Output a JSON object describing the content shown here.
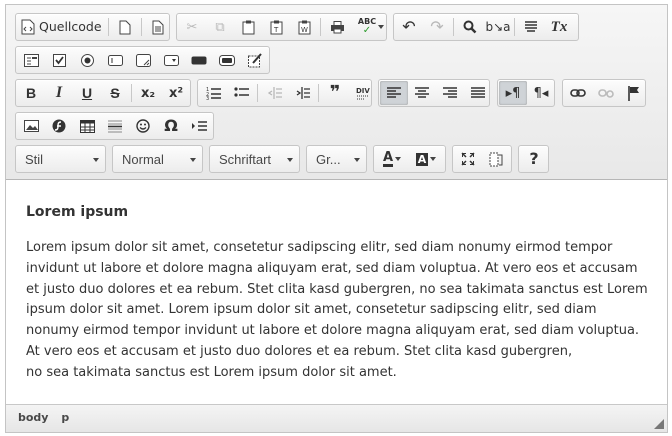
{
  "toolbar": {
    "source_label": "Quellcode",
    "combos": {
      "style": "Stil",
      "format": "Normal",
      "font": "Schriftart",
      "size": "Gr..."
    },
    "glyphs": {
      "bold": "B",
      "italic": "I",
      "underline": "U",
      "strike": "S",
      "subscript": "x₂",
      "superscript": "x²",
      "blockquote": "❞",
      "omega": "Ω",
      "help": "?",
      "font_color": "A",
      "bg_color": "A",
      "remove_format": "Tx",
      "spellcheck": "ABC"
    },
    "icons": [
      "source-icon",
      "new-page-icon",
      "preview-icon",
      "cut-icon",
      "copy-icon",
      "paste-icon",
      "paste-text-icon",
      "paste-word-icon",
      "print-icon",
      "spellcheck-icon",
      "undo-icon",
      "redo-icon",
      "find-icon",
      "replace-icon",
      "select-all-icon",
      "remove-format-icon",
      "form-icon",
      "checkbox-icon",
      "radio-icon",
      "textfield-icon",
      "textarea-icon",
      "select-icon",
      "button-icon",
      "image-button-icon",
      "hidden-field-icon",
      "numbered-list-icon",
      "bulleted-list-icon",
      "outdent-icon",
      "indent-icon",
      "blockquote-icon",
      "div-icon",
      "align-left-icon",
      "align-center-icon",
      "align-right-icon",
      "justify-icon",
      "ltr-icon",
      "rtl-icon",
      "link-icon",
      "unlink-icon",
      "anchor-icon",
      "image-icon",
      "flash-icon",
      "table-icon",
      "horizontal-rule-icon",
      "smiley-icon",
      "special-char-icon",
      "page-break-icon",
      "maximize-icon",
      "show-blocks-icon",
      "help-icon"
    ]
  },
  "content": {
    "heading": "Lorem ipsum",
    "lines": [
      "Lorem ipsum dolor sit amet, consetetur sadipscing elitr, sed diam nonumy eirmod tempor",
      "invidunt ut labore et dolore magna aliquyam erat, sed diam voluptua. At vero eos et accusam",
      "et justo duo dolores et ea rebum. Stet clita kasd gubergren, no sea takimata sanctus est Lorem",
      "ipsum dolor sit amet. Lorem ipsum dolor sit amet, consetetur sadipscing elitr, sed diam",
      "nonumy eirmod tempor invidunt ut labore et dolore magna aliquyam erat, sed diam voluptua.",
      "At vero eos et accusam et justo duo dolores et ea rebum. Stet clita kasd gubergren,",
      "no sea takimata sanctus est Lorem ipsum dolor sit amet."
    ]
  },
  "status": {
    "path": [
      "body",
      "p"
    ]
  },
  "colors": {
    "toolbar_bg": "#ececec",
    "active_button": "#cfd3d7",
    "text": "#333333"
  }
}
